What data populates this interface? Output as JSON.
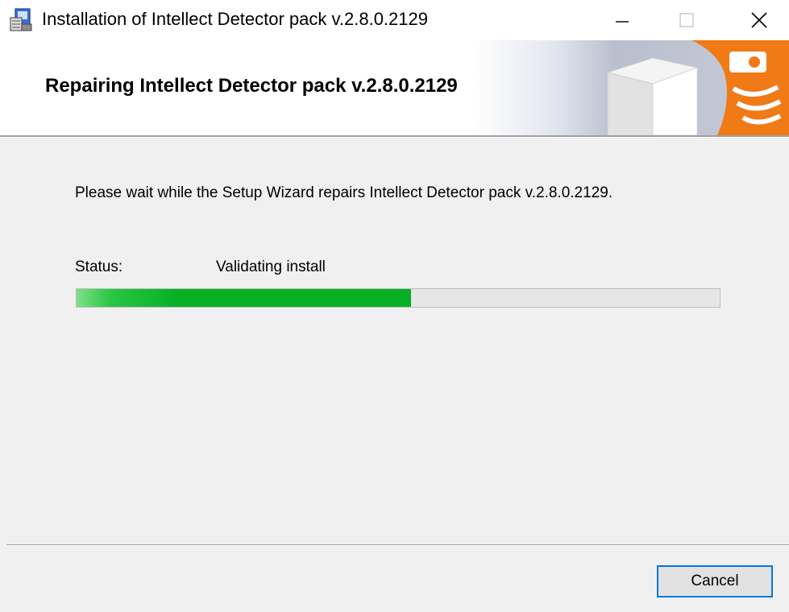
{
  "window": {
    "title": "Installation of Intellect Detector pack v.2.8.0.2129",
    "icons": {
      "app": "installer-icon",
      "minimize": "minimize-icon",
      "maximize": "maximize-icon",
      "close": "close-icon"
    }
  },
  "banner": {
    "title": "Repairing Intellect Detector pack v.2.8.0.2129",
    "art_icon": "software-box-icon"
  },
  "body": {
    "message": "Please wait while the Setup Wizard repairs Intellect Detector pack v.2.8.0.2129.",
    "status_label": "Status:",
    "status_value": "Validating install",
    "progress_percent": 52
  },
  "footer": {
    "cancel_label": "Cancel"
  },
  "colors": {
    "progress_fill": "#06b025",
    "progress_track": "#e6e6e6",
    "button_focus": "#0078d7",
    "brand_orange": "#f07a16"
  }
}
